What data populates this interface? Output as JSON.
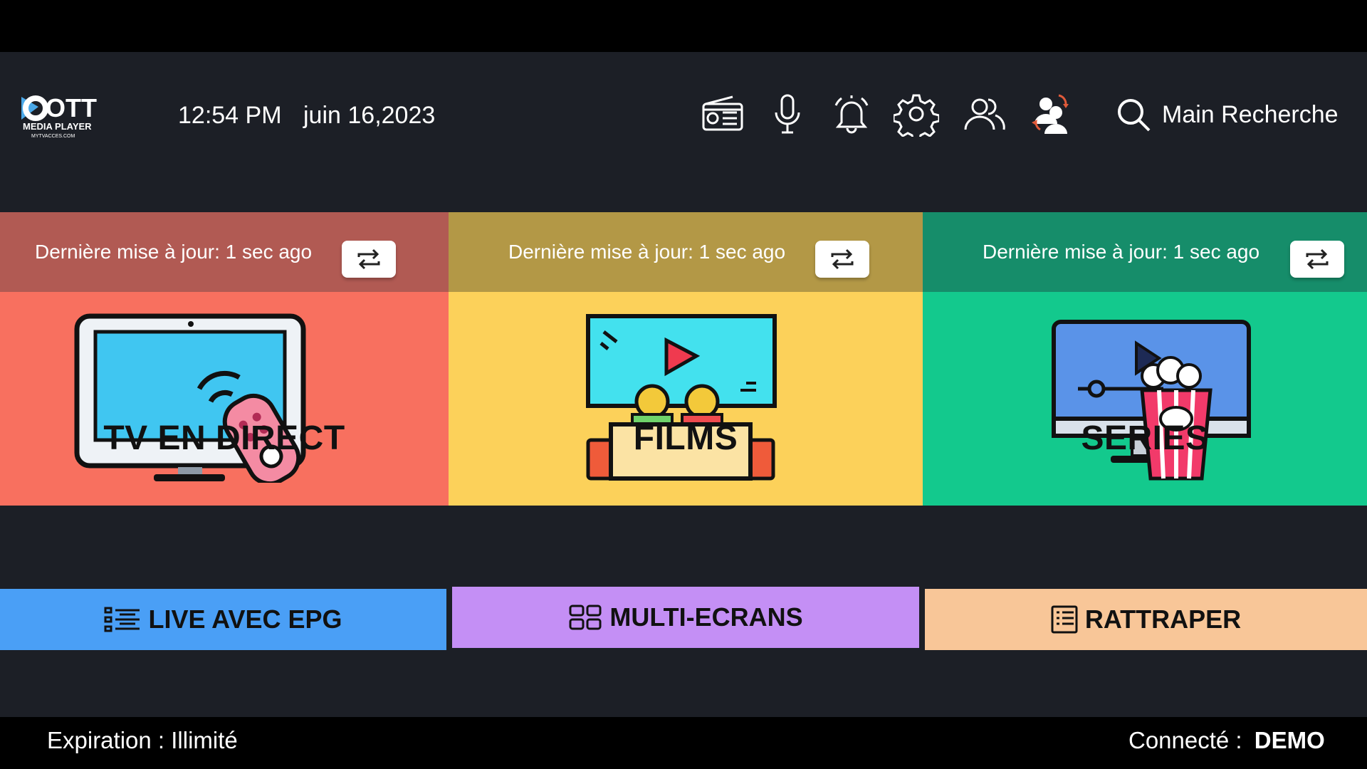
{
  "header": {
    "logo_text": "OTT",
    "logo_sub": "MEDIA PLAYER",
    "logo_url": "MYTVACCES.COM",
    "time": "12:54 PM",
    "date": "juin 16,2023",
    "search_label": "Main Recherche",
    "icons": [
      "radio-icon",
      "microphone-icon",
      "bell-icon",
      "gear-icon",
      "users-icon",
      "switch-user-icon",
      "search-icon"
    ]
  },
  "tiles": [
    {
      "id": "live",
      "title": "TV EN DIRECT",
      "update": "Dernière mise à jour: 1 sec ago",
      "color": "#f8705f",
      "bar": "#b15a53"
    },
    {
      "id": "films",
      "title": "FILMS",
      "update": "Dernière mise à jour: 1 sec ago",
      "color": "#fcd15a",
      "bar": "#b39846"
    },
    {
      "id": "series",
      "title": "SERIES",
      "update": "Dernière mise à jour: 1 sec ago",
      "color": "#13c98d",
      "bar": "#168d6a"
    }
  ],
  "buttons": {
    "epg": "LIVE AVEC EPG",
    "multi": "MULTI-ECRANS",
    "catchup": "RATTRAPER"
  },
  "footer": {
    "expiration_label": "Expiration : ",
    "expiration_value": "Illimité",
    "connected_label": "Connecté : ",
    "connected_value": "DEMO"
  }
}
